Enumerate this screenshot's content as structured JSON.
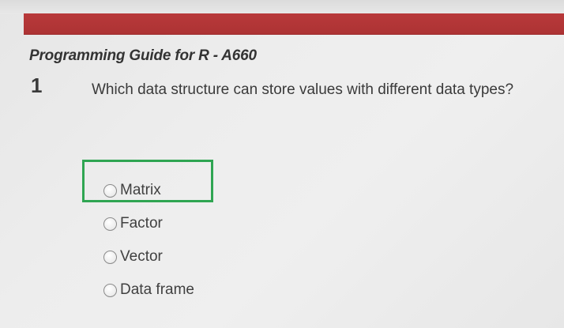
{
  "quiz": {
    "guide_title": "Programming Guide for R - A660",
    "question_number": "1",
    "question_text": "Which data structure can store values with different data types?",
    "options": [
      {
        "label": "Matrix",
        "selected": false
      },
      {
        "label": "Factor",
        "selected": false
      },
      {
        "label": "Vector",
        "selected": false
      },
      {
        "label": "Data frame",
        "selected": false
      }
    ],
    "highlighted_option": "Matrix"
  },
  "colors": {
    "header_bar": "#b8393a",
    "highlight_border": "#2fa552",
    "background": "#ececec"
  }
}
